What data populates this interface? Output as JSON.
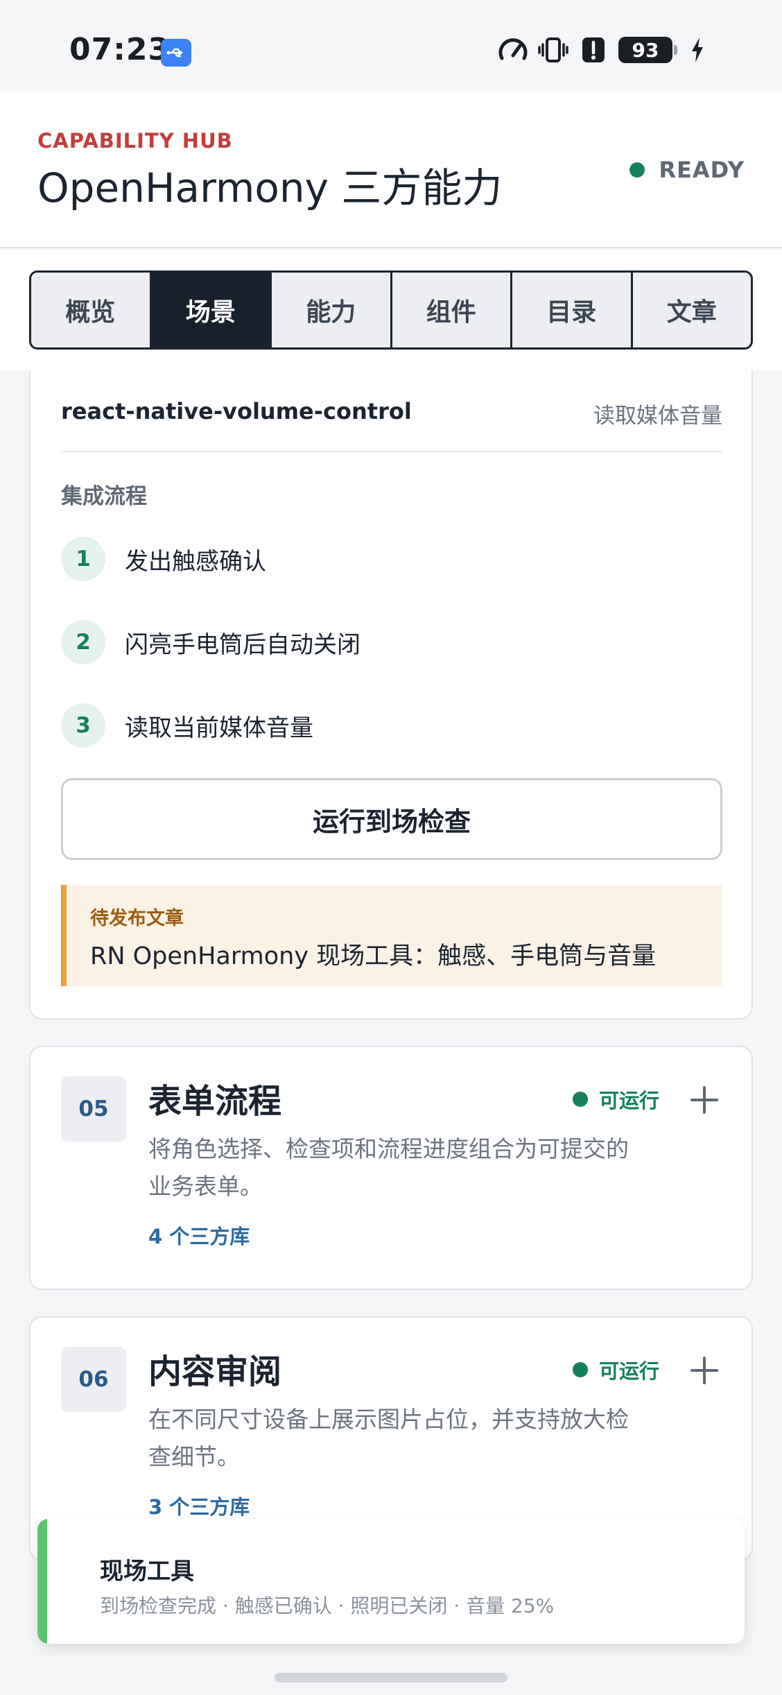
{
  "status_bar": {
    "time": "07:23",
    "battery": "93",
    "icons": [
      "usb-icon",
      "speedometer-icon",
      "vibrate-icon",
      "alert-icon",
      "battery-icon",
      "charging-icon"
    ]
  },
  "header": {
    "eyebrow": "CAPABILITY HUB",
    "title": "OpenHarmony 三方能力",
    "status": "READY"
  },
  "tabs": [
    {
      "label": "概览"
    },
    {
      "label": "场景"
    },
    {
      "label": "能力"
    },
    {
      "label": "组件"
    },
    {
      "label": "目录"
    },
    {
      "label": "文章"
    }
  ],
  "active_tab": "场景",
  "scenario": {
    "library_name": "react-native-volume-control",
    "library_desc": "读取媒体音量",
    "flow_label": "集成流程",
    "steps": [
      {
        "num": "1",
        "text": "发出触感确认"
      },
      {
        "num": "2",
        "text": "闪亮手电筒后自动关闭"
      },
      {
        "num": "3",
        "text": "读取当前媒体音量"
      }
    ],
    "run_button": "运行到场检查",
    "pending_label": "待发布文章",
    "pending_title": "RN OpenHarmony 现场工具：触感、手电筒与音量"
  },
  "items": [
    {
      "index": "05",
      "title": "表单流程",
      "status": "可运行",
      "desc": "将角色选择、检查项和流程进度组合为可提交的业务表单。",
      "libs": "4 个三方库"
    },
    {
      "index": "06",
      "title": "内容审阅",
      "status": "可运行",
      "desc": "在不同尺寸设备上展示图片占位，并支持放大检查细节。",
      "libs": "3 个三方库"
    }
  ],
  "toast": {
    "title": "现场工具",
    "message": "到场检查完成 · 触感已确认 · 照明已关闭 · 音量 25%"
  },
  "colors": {
    "accent_red": "#c43d3d",
    "ready_green": "#14805e",
    "tab_active": "#17202b",
    "link_blue": "#2b6aa0",
    "pending_bg": "#fbf2e6",
    "pending_border": "#e8a33b",
    "toast_bar": "#5cc46e"
  }
}
